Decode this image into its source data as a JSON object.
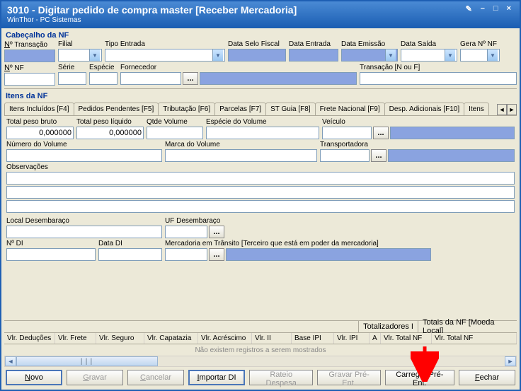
{
  "window": {
    "title": "3010 - Digitar pedido de compra master [Receber Mercadoria]",
    "subtitle": "WinThor - PC Sistemas",
    "btn_edit": "✎",
    "btn_min": "–",
    "btn_max": "□",
    "btn_close": "×"
  },
  "section_cabecalho": "Cabeçalho da NF",
  "header_row1": {
    "num_transacao": "Nº Transação",
    "filial": "Filial",
    "tipo_entrada": "Tipo Entrada",
    "data_selo": "Data Selo Fiscal",
    "data_entrada": "Data Entrada",
    "data_emissao": "Data Emissão",
    "data_saida": "Data Saída",
    "gera_nf": "Gera Nº NF"
  },
  "header_row2": {
    "num_nf": "Nº NF",
    "serie": "Série",
    "especie": "Espécie",
    "fornecedor": "Fornecedor",
    "transacao_nf": "Transação [N ou F]"
  },
  "section_itens": "Itens da NF",
  "tabs": [
    "Itens Incluídos [F4]",
    "Pedidos Pendentes [F5]",
    "Tributação [F6]",
    "Parcelas [F7]",
    "ST Guia [F8]",
    "Frete Nacional [F9]",
    "Desp. Adicionais [F10]",
    "Itens"
  ],
  "tabpane": {
    "total_bruto": "Total peso bruto",
    "total_bruto_val": "0,000000",
    "total_liquido": "Total peso líquido",
    "total_liquido_val": "0,000000",
    "qtde_volume": "Qtde Volume",
    "especie_volume": "Espécie do Volume",
    "veiculo": "Veículo",
    "numero_volume": "Número do Volume",
    "marca_volume": "Marca do Volume",
    "transportadora": "Transportadora",
    "observacoes": "Observações",
    "local_desemb": "Local Desembaraço",
    "uf_desemb": "UF Desembaraço",
    "num_di": "Nº DI",
    "data_di": "Data DI",
    "mercadoria_transito": "Mercadoria em Trânsito [Terceiro que está em poder da mercadoria]"
  },
  "totalizadores": {
    "label1": "Totalizadores I",
    "label2": "Totais da NF [Moeda Local]"
  },
  "grid_cols": [
    "Vlr. Deduções",
    "Vlr. Frete",
    "Vlr. Seguro",
    "Vlr. Capatazia",
    "Vlr. Acréscimo",
    "Vlr. II",
    "Base IPI",
    "Vlr. IPI",
    "A",
    "Vlr. Total NF",
    "Vlr. Total NF"
  ],
  "grid_empty": "Não existem registros a serem mostrados",
  "buttons": {
    "novo": "Novo",
    "gravar": "Gravar",
    "cancelar": "Cancelar",
    "importar_di": "Importar DI",
    "rateio": "Rateio Despesa",
    "gravar_pre": "Gravar Pré-Ent.",
    "carregar_pre": "Carregar Pré-Ent.",
    "fechar": "Fechar"
  }
}
